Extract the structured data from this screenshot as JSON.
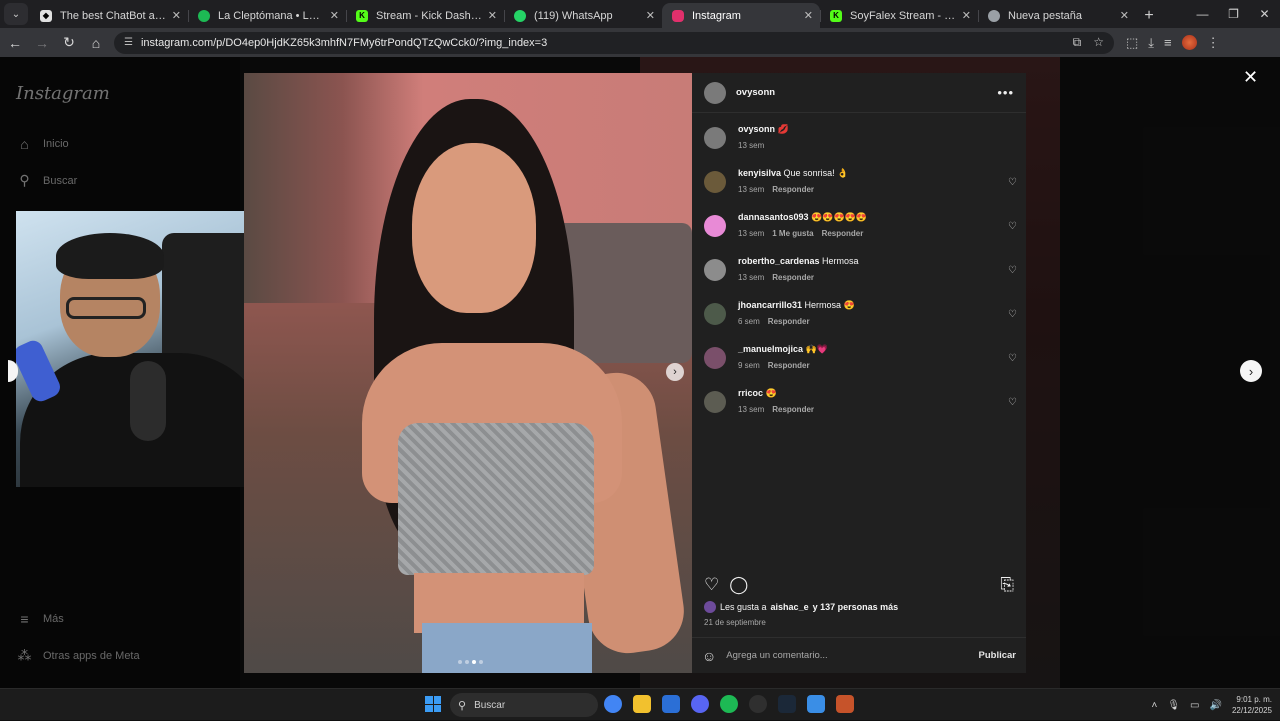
{
  "browser": {
    "tabs": [
      {
        "title": "The best ChatBot and Widgets",
        "active": false,
        "favicon_color": "#e0e0e0"
      },
      {
        "title": "La Cleptómana • Los Herm",
        "active": false,
        "favicon_color": "#1db954"
      },
      {
        "title": "Stream - Kick Dashboard",
        "active": false,
        "favicon_color": "#53fc18"
      },
      {
        "title": "(119) WhatsApp",
        "active": false,
        "favicon_color": "#25d366"
      },
      {
        "title": "Instagram",
        "active": true,
        "favicon_color": "#e1306c"
      },
      {
        "title": "SoyFalex Stream - Watch Live o",
        "active": false,
        "favicon_color": "#53fc18"
      },
      {
        "title": "Nueva pestaña",
        "active": false,
        "favicon_color": "#9aa0a6"
      }
    ],
    "url": "instagram.com/p/DO4ep0HjdKZ65k3mhfN7FMy6trPondQTzQwCck0/?img_index=3"
  },
  "instagram": {
    "logo": "Instagram",
    "nav": {
      "home": "Inicio",
      "search": "Buscar",
      "more": "Más",
      "meta_apps": "Otras apps de Meta"
    }
  },
  "post": {
    "author": "ovysonn",
    "caption": {
      "user": "ovysonn",
      "text": "💋",
      "time": "13 sem"
    },
    "comments": [
      {
        "user": "kenyisilva",
        "text": "Que sonrisa! 👌",
        "time": "13 sem",
        "likes": "",
        "reply": "Responder",
        "avatar_color": "#6b5a3a"
      },
      {
        "user": "dannasantos093",
        "text": "😍😍😍😍😍",
        "time": "13 sem",
        "likes": "1 Me gusta",
        "reply": "Responder",
        "avatar_color": "#e88ad6"
      },
      {
        "user": "robertho_cardenas",
        "text": "Hermosa",
        "time": "13 sem",
        "likes": "",
        "reply": "Responder",
        "avatar_color": "#8c8c8c"
      },
      {
        "user": "jhoancarrillo31",
        "text": "Hermosa 😍",
        "time": "6 sem",
        "likes": "",
        "reply": "Responder",
        "avatar_color": "#4d5a4a"
      },
      {
        "user": "_manuelmojica",
        "text": "🙌💗",
        "time": "9 sem",
        "likes": "",
        "reply": "Responder",
        "avatar_color": "#7a4f6a"
      },
      {
        "user": "rricoc",
        "text": "😍",
        "time": "13 sem",
        "likes": "",
        "reply": "Responder",
        "avatar_color": "#5c5c52"
      }
    ],
    "likes_text": "Les gusta a",
    "likes_user": "aishac_e",
    "likes_rest": "y 137 personas más",
    "date": "21 de septiembre",
    "comment_placeholder": "Agrega un comentario...",
    "publish_label": "Publicar"
  },
  "taskbar": {
    "search_label": "Buscar",
    "time": "9:01 p. m.",
    "date": "22/12/2025"
  }
}
